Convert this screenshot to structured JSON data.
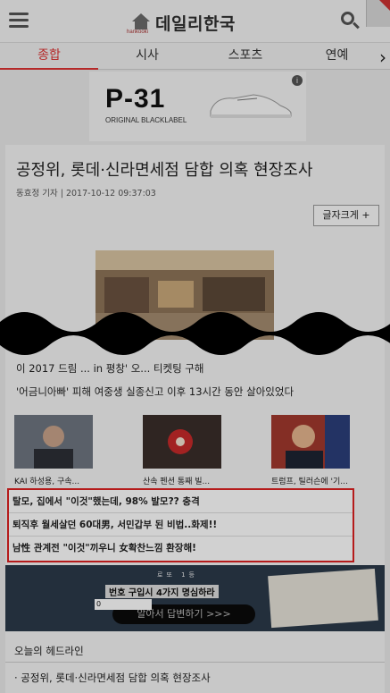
{
  "header": {
    "logo_text": "데일리한국",
    "logo_sub": "hankooki"
  },
  "tabs": [
    {
      "label": "종합",
      "active": true
    },
    {
      "label": "시사",
      "active": false
    },
    {
      "label": "스포츠",
      "active": false
    },
    {
      "label": "연예",
      "active": false
    }
  ],
  "ad": {
    "title": "P-31",
    "subtitle": "ORIGINAL BLACKLABEL",
    "info": "i"
  },
  "article": {
    "headline": "공정위, 롯데·신라면세점 담합 의혹 현장조사",
    "byline": "동효정 기자 | 2017-10-12 09:37:03",
    "font_size_button": "글자크게 +",
    "related_partial": "이 2017 드림 ... in 평창' 오... 티켓팅 구해",
    "related_line": "'어금니아빠' 피해 여중생 실종신고 이후 13시간 동안 살아있었다",
    "thumbs": [
      {
        "caption": "KAI 하성용, 구속..."
      },
      {
        "caption": "산속 펜션 통째 빌..."
      },
      {
        "caption": "트럼프, 틸러슨에 '기..."
      }
    ]
  },
  "promo": {
    "rows": [
      "탈모, 집에서 \"이것\"했는데, 98% 발모?? 충격",
      "퇴직후 월세살던 60대男, 서민갑부 된 비법..화제!!",
      "남性 관계전 \"이것\"끼우니 女확찬느낌 환장해!"
    ]
  },
  "lotto": {
    "top": "로또 1등",
    "title": "번호 구입시 4가지 명심하라",
    "input_value": "0",
    "button": "알아서 답변하기 >>>"
  },
  "headline_section": {
    "title": "오늘의 헤드라인",
    "item": "· 공정위, 롯데·신라면세점 담합 의혹 현장조사"
  }
}
